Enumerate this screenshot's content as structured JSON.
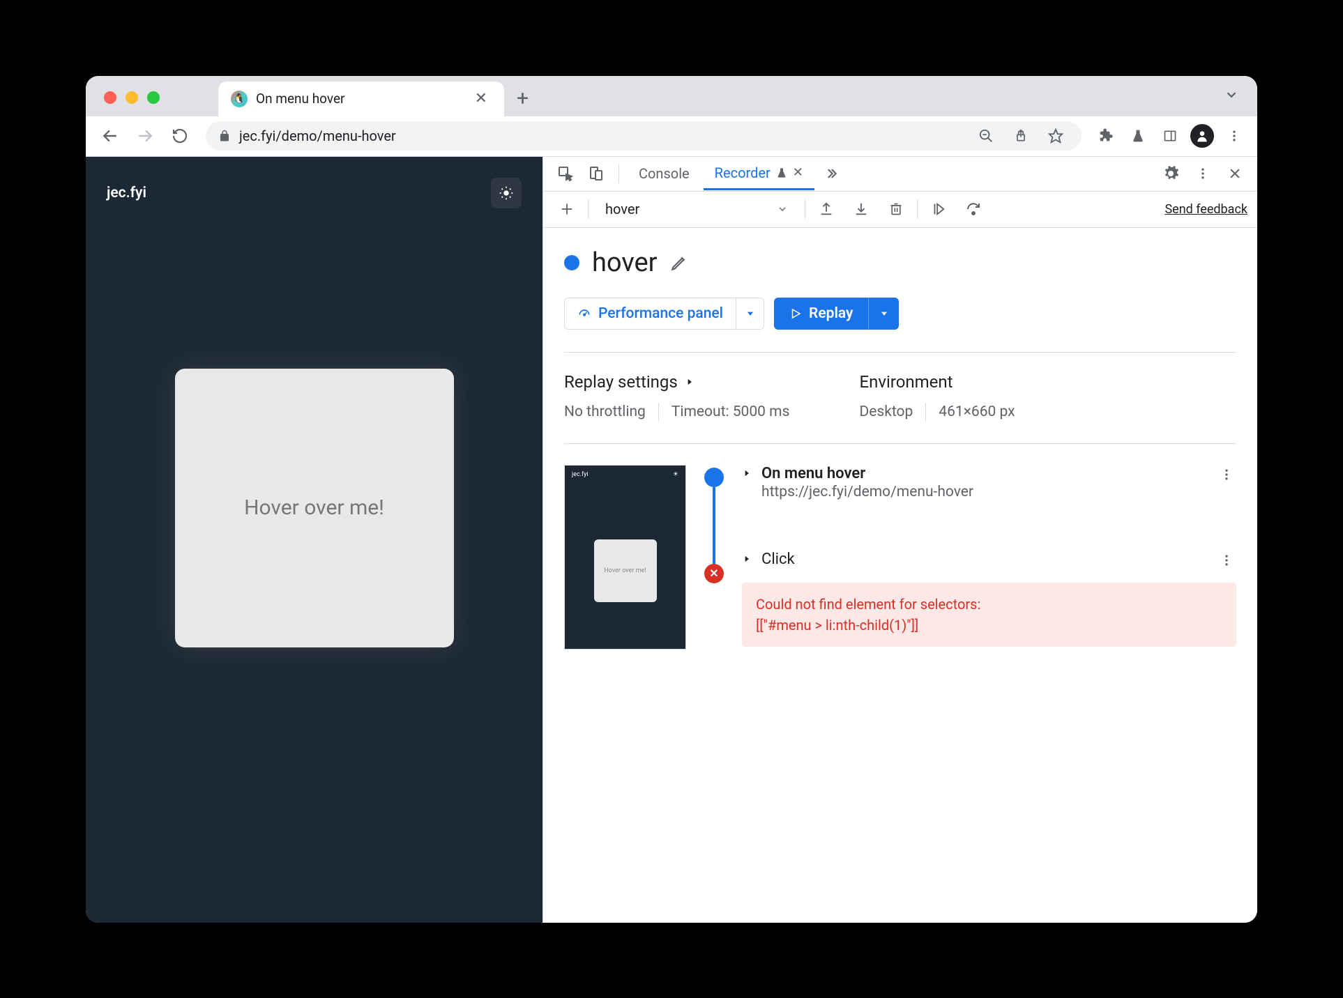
{
  "browser": {
    "tab_title": "On menu hover",
    "url": "jec.fyi/demo/menu-hover"
  },
  "page": {
    "site_name": "jec.fyi",
    "hover_card_text": "Hover over me!"
  },
  "devtools": {
    "tabs": {
      "console": "Console",
      "recorder": "Recorder"
    },
    "recorder_toolbar": {
      "recording_select": "hover",
      "feedback": "Send feedback"
    },
    "recording": {
      "title": "hover",
      "perf_button": "Performance panel",
      "replay_button": "Replay"
    },
    "settings": {
      "replay_heading": "Replay settings",
      "throttling": "No throttling",
      "timeout": "Timeout: 5000 ms",
      "env_heading": "Environment",
      "env_device": "Desktop",
      "env_viewport": "461×660 px"
    },
    "steps": {
      "thumb_site": "jec.fyi",
      "thumb_card": "Hover over me!",
      "step1_title": "On menu hover",
      "step1_url": "https://jec.fyi/demo/menu-hover",
      "step2_title": "Click",
      "error_line1": "Could not find element for selectors:",
      "error_line2": "[[\"#menu > li:nth-child(1)\"]]"
    }
  }
}
